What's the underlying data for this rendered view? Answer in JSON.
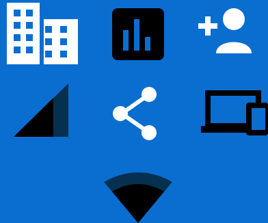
{
  "background_color": "#0a6ed1",
  "colors": {
    "white": "#ffffff",
    "black": "#000000",
    "shade_dark": "#06304f",
    "shade_mid": "#0a4a7e",
    "blue": "#0a6ed1"
  },
  "icons": [
    {
      "name": "building-icon",
      "row": 1,
      "col": 1
    },
    {
      "name": "bar-chart-icon",
      "row": 1,
      "col": 2
    },
    {
      "name": "add-person-icon",
      "row": 1,
      "col": 3
    },
    {
      "name": "signal-strength-icon",
      "row": 2,
      "col": 1
    },
    {
      "name": "share-icon",
      "row": 2,
      "col": 2
    },
    {
      "name": "devices-icon",
      "row": 2,
      "col": 3
    },
    {
      "name": "wifi-icon",
      "row": 3,
      "col": 2
    }
  ]
}
